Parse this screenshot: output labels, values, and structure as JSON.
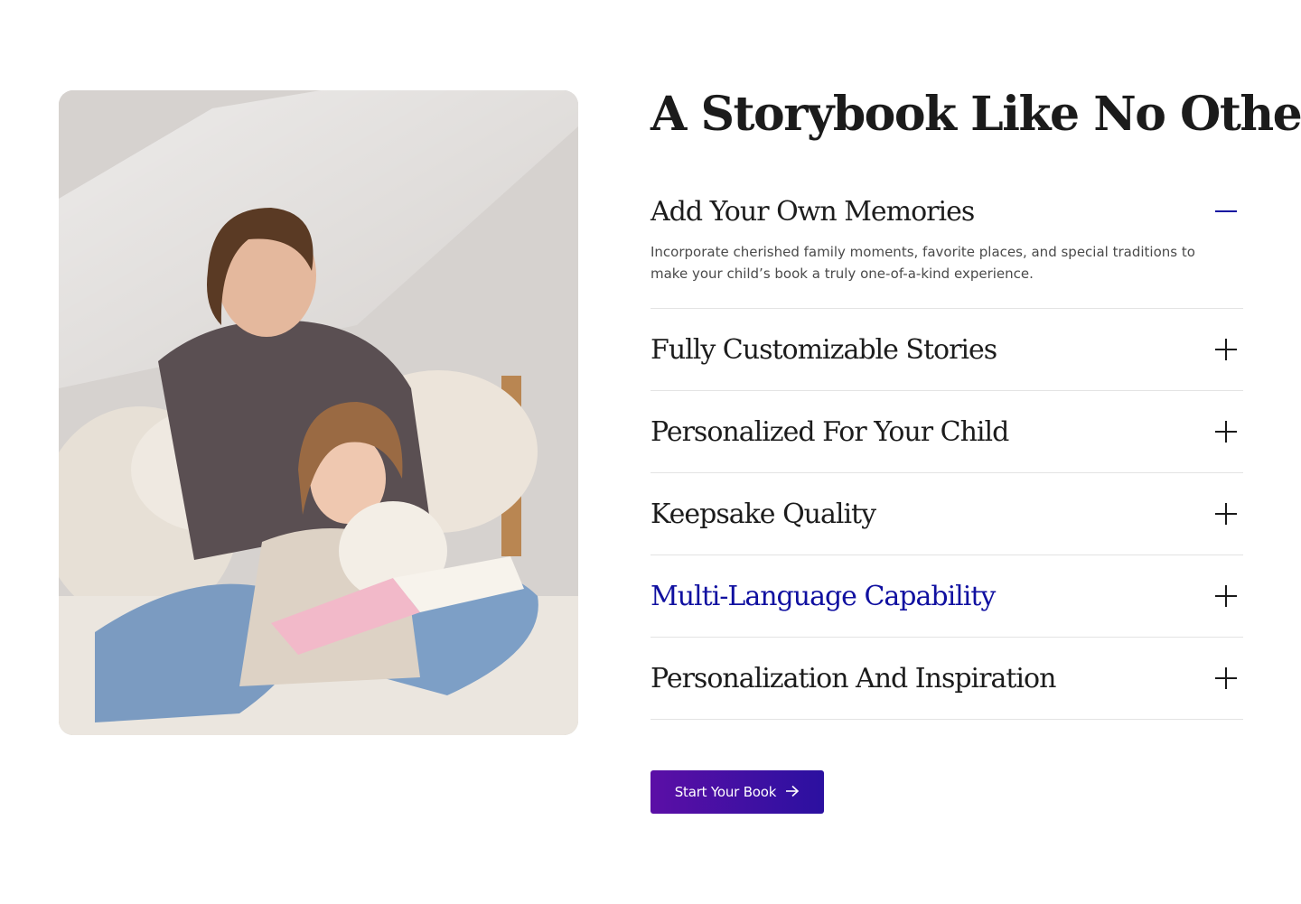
{
  "section": {
    "heading": "A Storybook Like No Other",
    "photo_alt": "Mother reading a storybook to her daughter on a bed"
  },
  "accordion": {
    "items": [
      {
        "title": "Add Your Own Memories",
        "expanded": true,
        "body": "Incorporate cherished family moments, favorite places, and special traditions to make your child’s book a truly one-of-a-kind experience.",
        "icon": "minus-icon"
      },
      {
        "title": "Fully Customizable Stories",
        "expanded": false,
        "icon": "plus-icon"
      },
      {
        "title": "Personalized For Your Child",
        "expanded": false,
        "icon": "plus-icon"
      },
      {
        "title": "Keepsake Quality",
        "expanded": false,
        "icon": "plus-icon"
      },
      {
        "title": "Multi-Language Capability",
        "expanded": false,
        "icon": "plus-icon",
        "highlighted": true
      },
      {
        "title": "Personalization And Inspiration",
        "expanded": false,
        "icon": "plus-icon"
      }
    ]
  },
  "cta": {
    "label": "Start Your Book",
    "icon": "arrow-right-icon"
  },
  "colors": {
    "heading": "#1b1b1b",
    "accent": "#1010a0",
    "button_start": "#5b0fa6",
    "button_end": "#2b10a0",
    "divider": "#e3e3e3",
    "body_text": "#4a4a4a"
  }
}
